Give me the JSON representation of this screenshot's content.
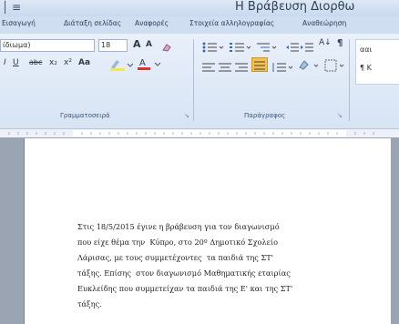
{
  "window": {
    "title": "Η Βράβευση Διορθω",
    "quick_access": "│ ≡"
  },
  "tabs": [
    {
      "label": "Εισαγωγή"
    },
    {
      "label": "Διάταξη σελίδας"
    },
    {
      "label": "Αναφορές"
    },
    {
      "label": "Στοιχεία αλληλογραφίας"
    },
    {
      "label": "Αναθεώρηση"
    }
  ],
  "font_group": {
    "label": "Γραμματοσειρά",
    "font_name": "ίδιωμα)",
    "font_size": "18",
    "grow": "A",
    "shrink": "A",
    "underline": "U",
    "strike": "abc",
    "subscript": "x₂",
    "superscript": "x²",
    "case": "Aa"
  },
  "paragraph_group": {
    "label": "Παράγραφος"
  },
  "styles_group": {
    "preview_top": "ααι",
    "preview_bottom": "¶ Κ"
  },
  "document": {
    "lines": [
      "Στις 18/5/2015 έγινε η βράβευση για τον διαγωνισμό",
      "που είχε θέμα την  Κύπρο, στο 20º Δημοτικό Σχολείο",
      "Λάρισας, με τους συμμετέχοντες  τα παιδιά της ΣΤ'",
      "τάξης. Επίσης  στον διαγωνισμό Μαθηματικής εταιρίας",
      "Ευκλείδης που συμμετείχαν τα παιδιά της Ε' και της ΣΤ'",
      "τάξης."
    ]
  },
  "colors": {
    "highlight": "#f5e84a",
    "font_color": "#d9332b"
  }
}
